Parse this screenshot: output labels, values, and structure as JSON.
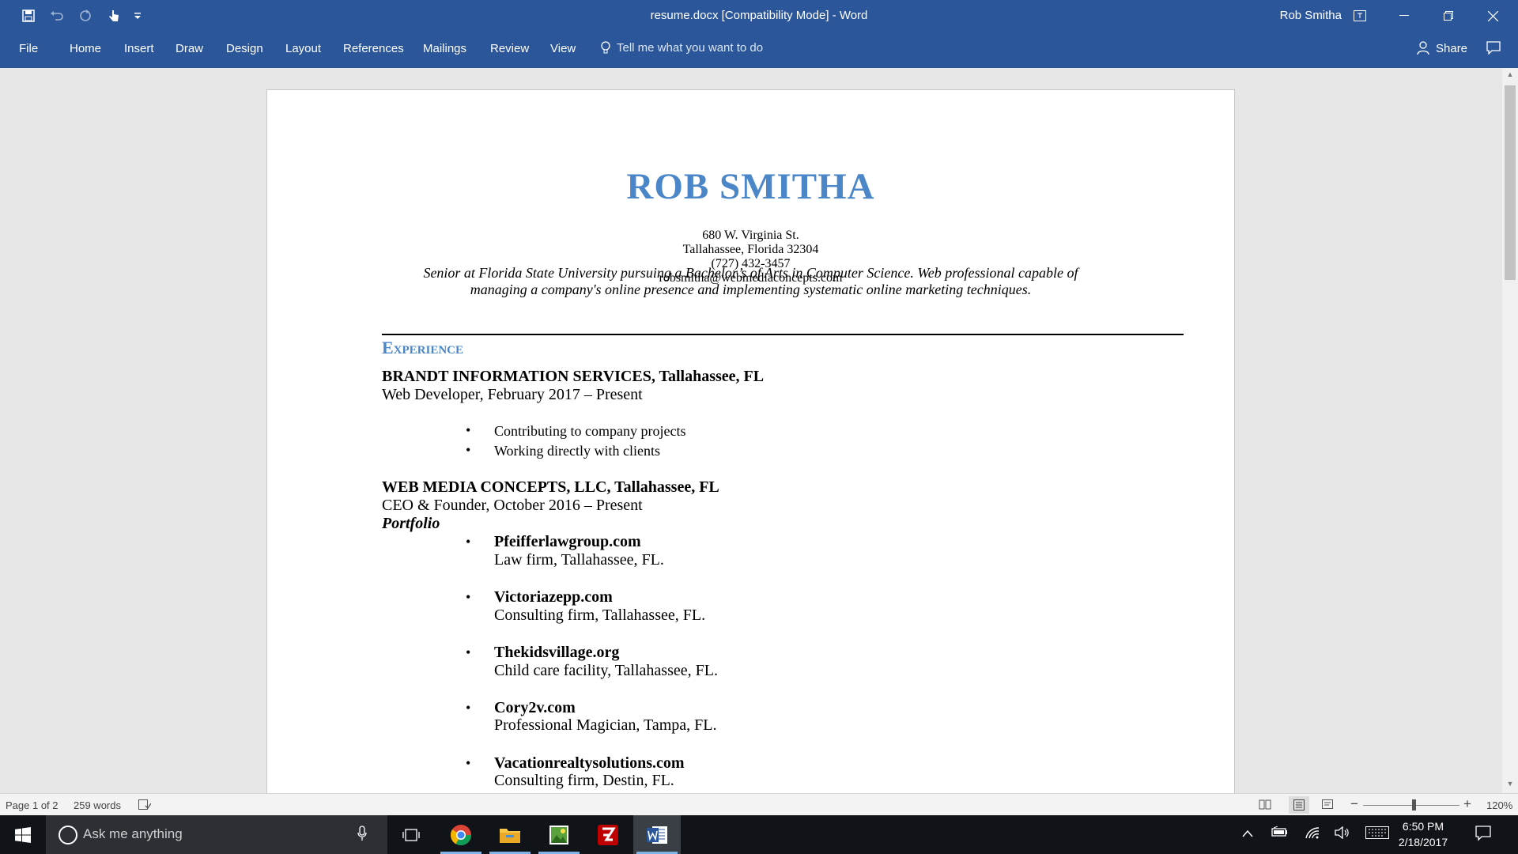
{
  "window": {
    "title": "resume.docx [Compatibility Mode]  -  Word",
    "user": "Rob Smitha"
  },
  "ribbon": {
    "tabs": [
      "File",
      "Home",
      "Insert",
      "Draw",
      "Design",
      "Layout",
      "References",
      "Mailings",
      "Review",
      "View"
    ],
    "tell_me": "Tell me what you want to do",
    "share": "Share"
  },
  "document": {
    "name": "ROB SMITHA",
    "address1": "680 W. Virginia St.",
    "address2": "Tallahassee, Florida 32304",
    "phone": "(727) 432-3457",
    "email": "robsmitha@webmediaconcepts.com",
    "summary_line1": "Senior at Florida State University pursuing a Bachelor’s of Arts in Computer Science. Web professional capable of",
    "summary_line2": "managing a company's online presence and implementing systematic online marketing techniques.",
    "section_experience": "Experience",
    "job1": {
      "company": "BRANDT INFORMATION SERVICES, Tallahassee, FL",
      "role": "Web Developer, February 2017 – Present",
      "bullets": [
        "Contributing to company projects",
        "Working directly with clients"
      ]
    },
    "job2": {
      "company": "WEB MEDIA CONCEPTS, LLC, Tallahassee, FL",
      "role": "CEO & Founder, October 2016 – Present",
      "portfolio_label": "Portfolio",
      "items": [
        {
          "title": "Pfeifferlawgroup.com",
          "desc": "Law firm, Tallahassee, FL."
        },
        {
          "title": "Victoriazepp.com",
          "desc": "Consulting firm, Tallahassee, FL."
        },
        {
          "title": "Thekidsvillage.org",
          "desc": "Child care facility, Tallahassee, FL."
        },
        {
          "title": "Cory2v.com",
          "desc": "Professional Magician, Tampa, FL."
        },
        {
          "title": "Vacationrealtysolutions.com",
          "desc": "Consulting firm, Destin, FL."
        }
      ]
    }
  },
  "status": {
    "page": "Page 1 of 2",
    "words": "259 words",
    "zoom": "120%"
  },
  "taskbar": {
    "search_placeholder": "Ask me anything",
    "time": "6:50 PM",
    "date": "2/18/2017",
    "apps": [
      "chrome-icon",
      "file-explorer-icon",
      "photos-icon",
      "filezilla-icon",
      "word-icon"
    ]
  },
  "colors": {
    "word_blue": "#2b579a",
    "heading_blue": "#4a86c8",
    "taskbar": "#101418"
  }
}
